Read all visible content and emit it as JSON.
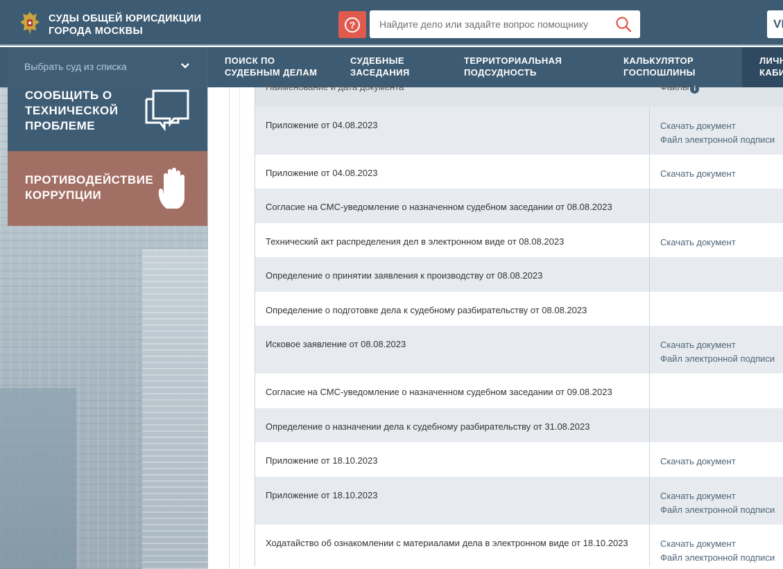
{
  "header": {
    "brand_line1": "СУДЫ ОБЩЕЙ ЮРИСДИКЦИИ",
    "brand_line2": "ГОРОДА МОСКВЫ",
    "search_placeholder": "Найдите дело или задайте вопрос помощнику",
    "help_symbol": "?",
    "vk_label": "VK"
  },
  "nav": {
    "court_select": "Выбрать суд из списка",
    "items": [
      {
        "line1": "ПОИСК ПО",
        "line2": "СУДЕБНЫМ ДЕЛАМ"
      },
      {
        "line1": "СУДЕБНЫЕ",
        "line2": "ЗАСЕДАНИЯ"
      },
      {
        "line1": "ТЕРРИТОРИАЛЬНАЯ",
        "line2": "ПОДСУДНОСТЬ"
      },
      {
        "line1": "КАЛЬКУЛЯТОР",
        "line2": "ГОСПОШЛИНЫ"
      },
      {
        "line1": "ЛИЧН",
        "line2": "КАБИ"
      }
    ]
  },
  "sidebar": {
    "report": {
      "line1": "СООБЩИТЬ О",
      "line2": "ТЕХНИЧЕСКОЙ",
      "line3": "ПРОБЛЕМЕ"
    },
    "corruption": {
      "line1": "ПРОТИВОДЕЙСТВИЕ",
      "line2": "КОРРУПЦИИ"
    }
  },
  "table": {
    "col_name": "Наименование и дата документа",
    "col_files": "Файлы",
    "link_download": "Скачать документ",
    "link_signature": "Файл электронной подписи",
    "rows": [
      {
        "name": "Приложение от 04.08.2023",
        "download": "Скачать документ",
        "signature": "Файл электронной подписи"
      },
      {
        "name": "Приложение от 04.08.2023",
        "download": "Скачать документ",
        "signature": ""
      },
      {
        "name": "Согласие на СМС-уведомление о назначенном судебном заседании от 08.08.2023",
        "download": "",
        "signature": ""
      },
      {
        "name": "Технический акт распределения дел в электронном виде от 08.08.2023",
        "download": "Скачать документ",
        "signature": ""
      },
      {
        "name": "Определение о принятии заявления к производству от 08.08.2023",
        "download": "",
        "signature": ""
      },
      {
        "name": "Определение о подготовке дела к судебному разбирательству от 08.08.2023",
        "download": "",
        "signature": ""
      },
      {
        "name": "Исковое заявление от 08.08.2023",
        "download": "Скачать документ",
        "signature": "Файл электронной подписи"
      },
      {
        "name": "Согласие на СМС-уведомление о назначенном судебном заседании от 09.08.2023",
        "download": "",
        "signature": ""
      },
      {
        "name": "Определение о назначении дела к судебному разбирательству от 31.08.2023",
        "download": "",
        "signature": ""
      },
      {
        "name": "Приложение от 18.10.2023",
        "download": "Скачать документ",
        "signature": ""
      },
      {
        "name": "Приложение от 18.10.2023",
        "download": "Скачать документ",
        "signature": "Файл электронной подписи"
      },
      {
        "name": "Ходатайство об ознакомлении с материалами дела в электронном виде от 18.10.2023",
        "download": "Скачать документ",
        "signature": "Файл электронной подписи"
      }
    ]
  },
  "colors": {
    "header_bg": "#3d5b73",
    "help_red": "#e05a4e",
    "corruption_bg": "#a26f65",
    "row_alt": "#e7ebef",
    "link": "#4d6478"
  }
}
